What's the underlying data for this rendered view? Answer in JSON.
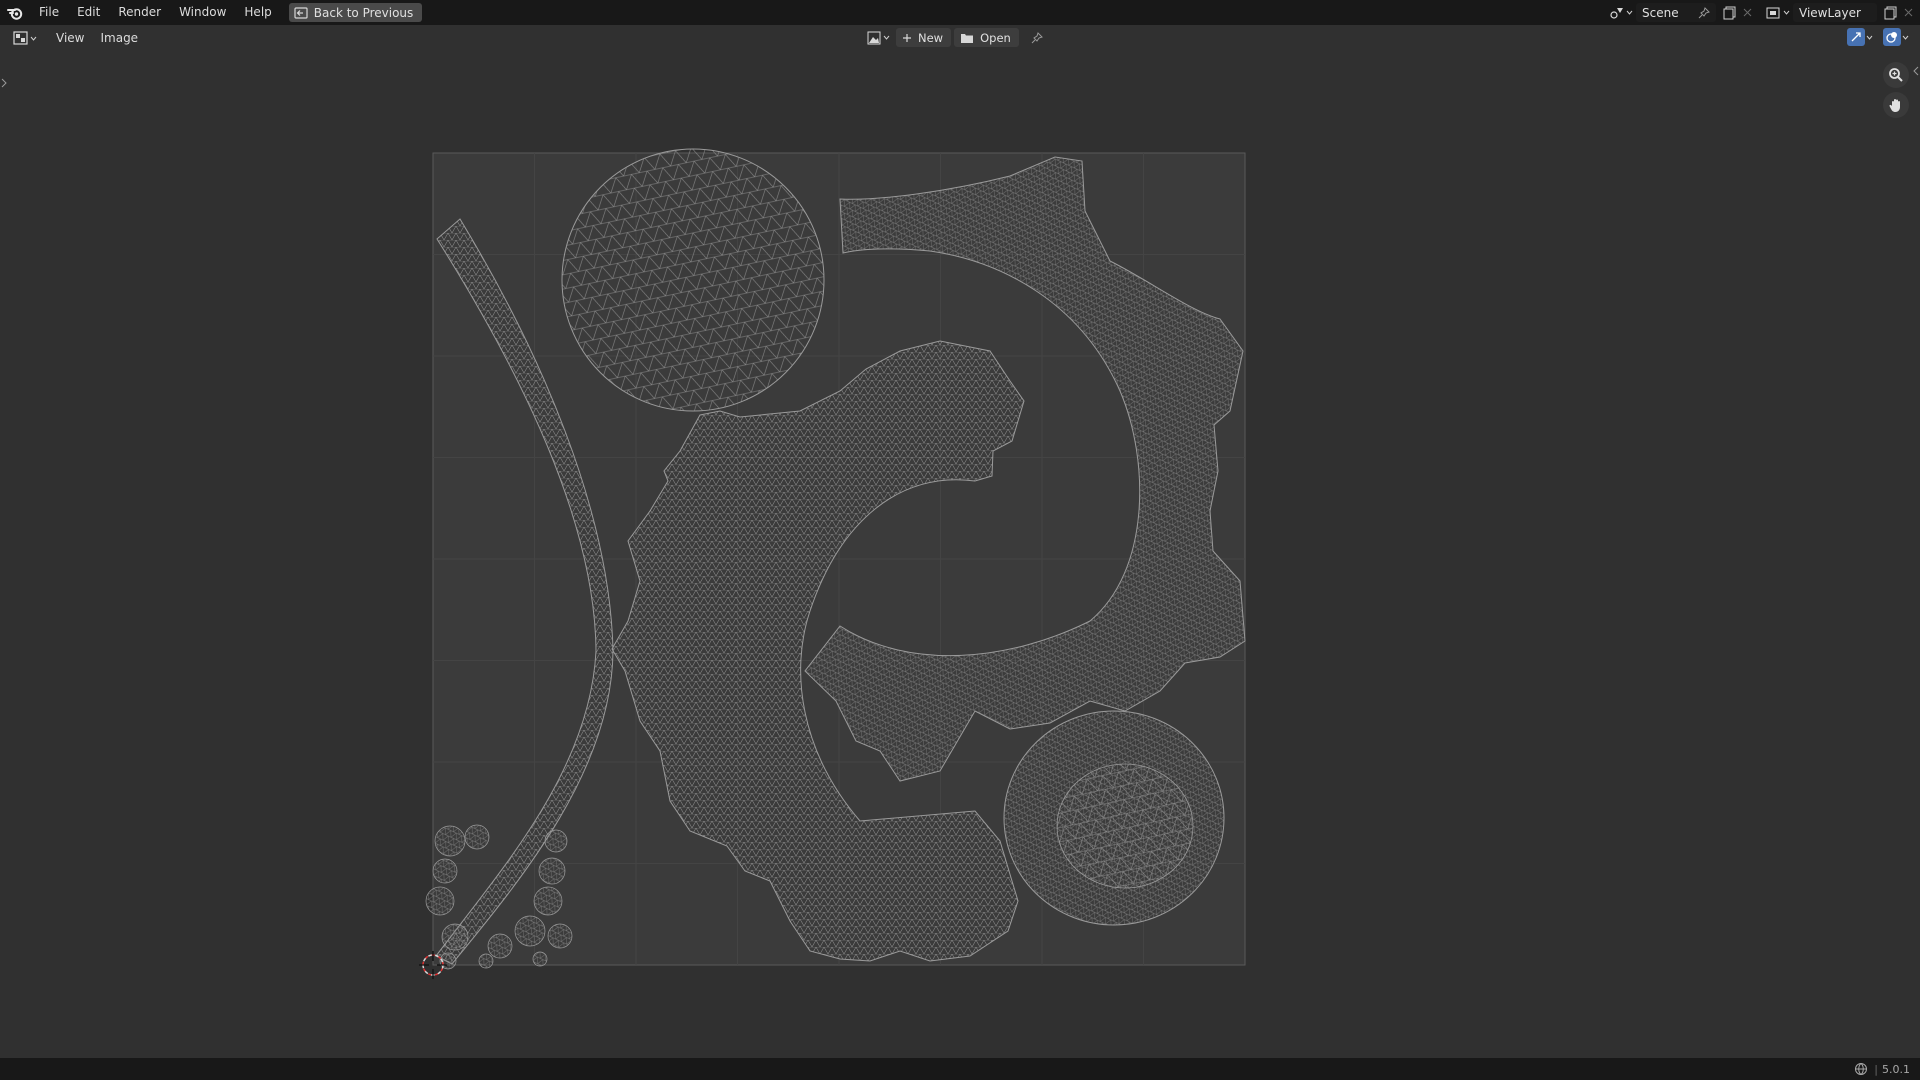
{
  "app": {
    "name": "Blender",
    "version": "5.0.1"
  },
  "topbar": {
    "menus": [
      "File",
      "Edit",
      "Render",
      "Window",
      "Help"
    ],
    "back_label": "Back to Previous",
    "scene_name": "Scene",
    "view_layer_name": "ViewLayer"
  },
  "header": {
    "editor_type_icon": "image-editor-icon",
    "menus": [
      "View",
      "Image"
    ],
    "new_label": "New",
    "open_label": "Open"
  },
  "viewport": {
    "icons": [
      "zoom-icon",
      "pan-hand-icon",
      "cursor-2d-icon"
    ]
  },
  "status": {
    "version": "5.0.1"
  },
  "colors": {
    "topbar_bg": "#181818",
    "editor_bg": "#303030",
    "image_bg": "#3b3b3b",
    "uv_mesh": "#8c8c8c",
    "accent_blue": "#4772b3"
  }
}
